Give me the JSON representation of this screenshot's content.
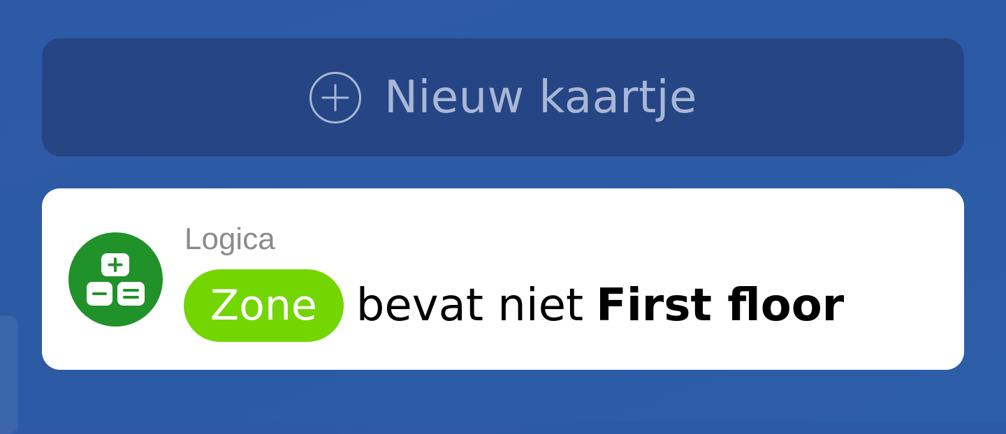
{
  "new_card": {
    "label": "Nieuw kaartje",
    "icon": "plus-circle-icon"
  },
  "rule_card": {
    "icon": "calculator-logic-icon",
    "category": "Logica",
    "chip": "Zone",
    "operator": "bevat niet",
    "value": "First floor"
  },
  "colors": {
    "background": "#2c5aa5",
    "button_background": "#264584",
    "button_text": "#a9b7d6",
    "logic_icon": "#21912a",
    "zone_chip": "#73d600",
    "category_text": "#8a8a8f"
  }
}
